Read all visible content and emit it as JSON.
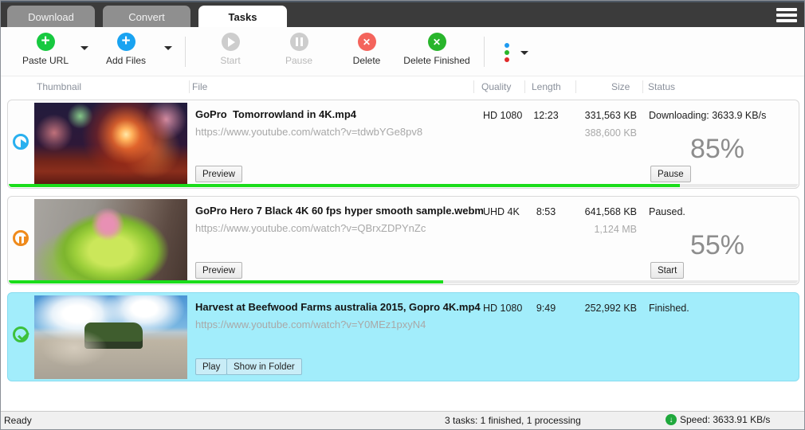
{
  "window": {
    "tabs": [
      {
        "label": "Download",
        "active": false
      },
      {
        "label": "Convert",
        "active": false
      },
      {
        "label": "Tasks",
        "active": true
      }
    ]
  },
  "toolbar": {
    "paste_url": "Paste URL",
    "add_files": "Add Files",
    "start": "Start",
    "pause": "Pause",
    "delete": "Delete",
    "delete_finished": "Delete Finished"
  },
  "table": {
    "columns": [
      "Thumbnail",
      "File",
      "Quality",
      "Length",
      "Size",
      "Status"
    ]
  },
  "tasks": [
    {
      "state": "downloading",
      "thumb": "fireworks",
      "title": "GoPro  Tomorrowland in 4K.mp4",
      "url": "https://www.youtube.com/watch?v=tdwbYGe8pv8",
      "quality": "HD 1080",
      "length": "12:23",
      "size_downloaded": "331,563 KB",
      "size_total": "388,600 KB",
      "status": "Downloading: 3633.9 KB/s",
      "percent_label": "85%",
      "progress": 85,
      "buttons": [
        "Preview"
      ],
      "action_button": "Pause",
      "selected": false
    },
    {
      "state": "paused",
      "thumb": "flowers",
      "title": "GoPro Hero 7 Black 4K 60 fps hyper smooth sample.webm",
      "url": "https://www.youtube.com/watch?v=QBrxZDPYnZc",
      "quality": "UHD 4K",
      "length": "8:53",
      "size_downloaded": "641,568 KB",
      "size_total": "1,124 MB",
      "status": "Paused.",
      "percent_label": "55%",
      "progress": 55,
      "buttons": [
        "Preview"
      ],
      "action_button": "Start",
      "selected": false
    },
    {
      "state": "finished",
      "thumb": "tractor",
      "title": "Harvest at Beefwood Farms australia 2015, Gopro 4K.mp4",
      "url": "https://www.youtube.com/watch?v=Y0MEz1pxyN4",
      "quality": "HD 1080",
      "length": "9:49",
      "size_downloaded": "252,992 KB",
      "size_total": "",
      "status": "Finished.",
      "percent_label": "",
      "progress": 0,
      "buttons": [
        "Play",
        "Show in Folder"
      ],
      "action_button": "",
      "selected": true
    }
  ],
  "statusbar": {
    "ready": "Ready",
    "tasks_summary": "3 tasks: 1 finished, 1 processing",
    "speed": "Speed: 3633.91 KB/s"
  },
  "colors": {
    "progress_green": "#1bdd1b",
    "selected_row_bg": "#a2edfb",
    "paste_url_green": "#17c940",
    "add_files_blue": "#19a3f1",
    "delete_red": "#f4645c",
    "delete_finished_green": "#28b52b",
    "downloading_blue": "#29b0ef",
    "paused_orange": "#ef8a1b",
    "finished_green": "#3cc13c",
    "topbar_dark": "#3b3b3b"
  }
}
